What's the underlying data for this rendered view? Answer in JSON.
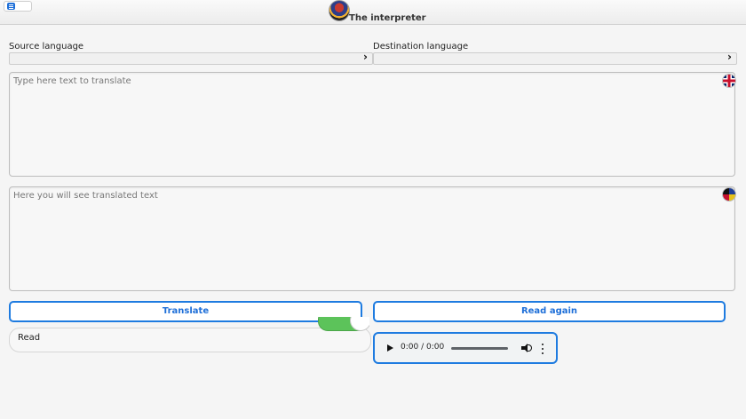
{
  "header": {
    "title": "The interpreter",
    "menu_icon": "menu-icon",
    "logo_icon": "interpreter-logo"
  },
  "source": {
    "label": "Source language",
    "value": "",
    "flag_icon": "uk-flag-icon"
  },
  "destination": {
    "label": "Destination language",
    "value": "",
    "flag_icon": "destination-flag-icon"
  },
  "input": {
    "placeholder": "Type here text to translate",
    "value": ""
  },
  "output": {
    "placeholder": "Here you will see translated text",
    "value": ""
  },
  "buttons": {
    "translate": "Translate",
    "read_again": "Read again"
  },
  "read": {
    "label": "Read",
    "toggle_on": true
  },
  "audio": {
    "time": "0:00 / 0:00"
  },
  "colors": {
    "accent": "#1e7be0",
    "toggle": "#5cc35a"
  }
}
